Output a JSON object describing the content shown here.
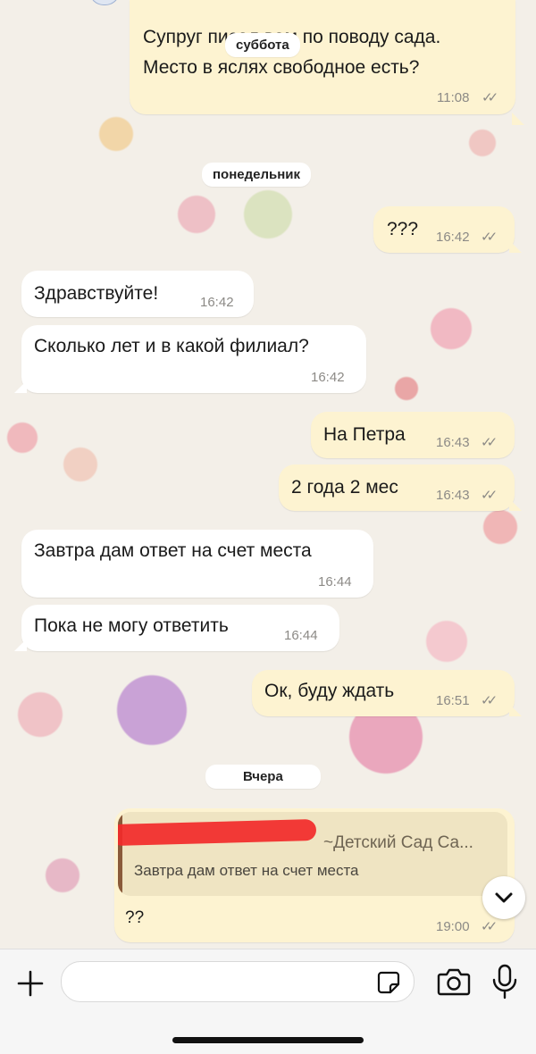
{
  "messages": {
    "m0": {
      "text1": "Супруг писал вам по поводу сада.",
      "text2": "Место в яслях свободное есть?",
      "time": "11:08"
    },
    "m1": {
      "text": "???",
      "time": "16:42"
    },
    "m2": {
      "text": "Здравствуйте!",
      "time": "16:42"
    },
    "m3": {
      "text": "Сколько лет и в какой филиал?",
      "time": "16:42"
    },
    "m4": {
      "text": "На Петра",
      "time": "16:43"
    },
    "m5": {
      "text": "2 года 2 мес",
      "time": "16:43"
    },
    "m6": {
      "text": "Завтра дам ответ на счет места",
      "time": "16:44"
    },
    "m7": {
      "text": "Пока не могу ответить",
      "time": "16:44"
    },
    "m8": {
      "text": "Ок, буду ждать",
      "time": "16:51"
    },
    "m9": {
      "reply_sender": "~Детский Сад Са...",
      "reply_text": "Завтра дам ответ на счет места",
      "text": "??",
      "time": "19:00"
    }
  },
  "day_separators": {
    "saturday": "суббота",
    "monday": "понедельник",
    "yesterday": "Вчера"
  },
  "status_ticks": "✓✓",
  "input": {
    "placeholder": ""
  },
  "icons": {
    "plus": "plus-icon",
    "sticker": "sticker-icon",
    "camera": "camera-icon",
    "mic": "microphone-icon",
    "scroll_down": "chevron-down-icon"
  },
  "colors": {
    "outgoing_bubble": "#fdf3d1",
    "incoming_bubble": "#ffffff",
    "reply_bar": "#8a5a3a",
    "redaction": "#f22a2a"
  }
}
